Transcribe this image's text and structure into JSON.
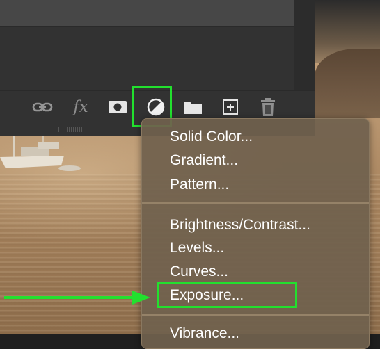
{
  "toolbar": {
    "icons": [
      "link-layers-icon",
      "fx-icon",
      "mask-icon",
      "adjustment-layer-icon",
      "group-folder-icon",
      "new-layer-icon",
      "trash-icon"
    ],
    "fx_label": "fx"
  },
  "menu": {
    "group1": [
      "Solid Color...",
      "Gradient...",
      "Pattern..."
    ],
    "group2": [
      "Brightness/Contrast...",
      "Levels...",
      "Curves...",
      "Exposure..."
    ],
    "group3": [
      "Vibrance..."
    ]
  },
  "annotation": {
    "highlight_color": "#22e02e",
    "arrow_color": "#22e02e"
  }
}
